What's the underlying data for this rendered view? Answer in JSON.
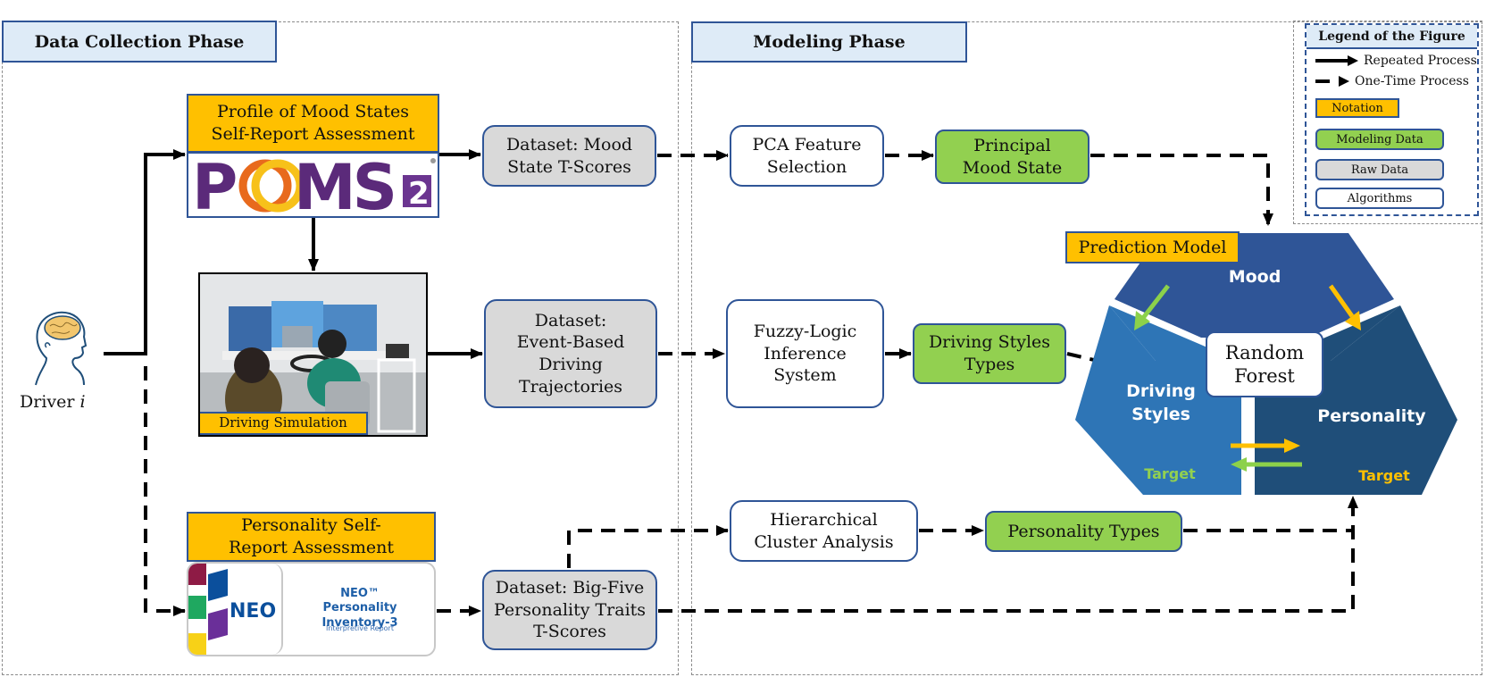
{
  "phases": {
    "data_collection": "Data Collection Phase",
    "modeling": "Modeling Phase"
  },
  "legend": {
    "title": "Legend of the Figure",
    "repeated": "Repeated Process",
    "one_time": "One-Time Process",
    "notation": "Notation",
    "modeling_data": "Modeling Data",
    "raw_data": "Raw Data",
    "algorithms": "Algorithms"
  },
  "driver": {
    "label": "Driver",
    "index": "i",
    "icon": "head-brain-icon"
  },
  "assessments": {
    "poms_title": "Profile of Mood States Self-Report Assessment",
    "poms_logo": "POMS",
    "poms_logo_sup": "2",
    "simulation_label": "Driving Simulation",
    "personality_title": "Personality Self-Report Assessment",
    "neo_logo": "NEO",
    "neo_product": "NEO™ Personality Inventory-3",
    "neo_report": "Interpretive Report"
  },
  "datasets": {
    "mood": "Dataset: Mood State T-Scores",
    "driving": "Dataset: Event-Based Driving Trajectories",
    "personality": "Dataset: Big-Five Personality Traits T-Scores"
  },
  "algorithms": {
    "pca": "PCA Feature Selection",
    "fuzzy": "Fuzzy-Logic Inference System",
    "cluster": "Hierarchical Cluster Analysis"
  },
  "modeling_data": {
    "mood": "Principal Mood State",
    "driving": "Driving Styles Types",
    "personality": "Personality Types"
  },
  "prediction": {
    "title": "Prediction Model",
    "core": "Random Forest",
    "mood": "Mood",
    "driving": "Driving Styles",
    "personality": "Personality",
    "target_left": "Target",
    "target_right": "Target"
  },
  "colors": {
    "notation": "#ffc000",
    "modeling_data": "#92d050",
    "raw_data": "#d9d9d9",
    "border": "#2f5597",
    "header_fill": "#deebf7",
    "mood_segment": "#2f5597",
    "driving_segment": "#2e75b6",
    "personality_segment": "#1f4e79"
  }
}
